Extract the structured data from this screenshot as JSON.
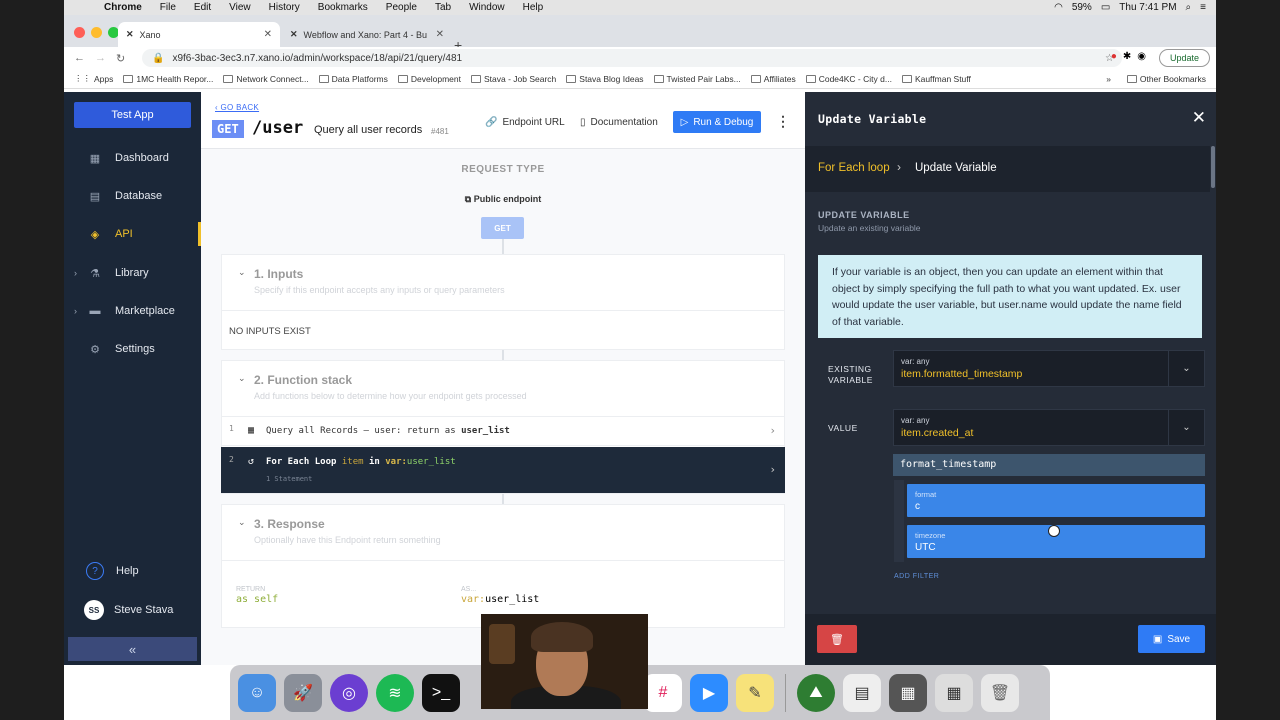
{
  "menubar": {
    "app": "Chrome",
    "items": [
      "File",
      "Edit",
      "View",
      "History",
      "Bookmarks",
      "People",
      "Tab",
      "Window",
      "Help"
    ],
    "battery": "59%",
    "clock": "Thu 7:41 PM"
  },
  "tabs": [
    {
      "title": "Xano"
    },
    {
      "title": "Webflow and Xano: Part 4 - Bu"
    }
  ],
  "address": {
    "url": "x9f6-3bac-3ec3.n7.xano.io/admin/workspace/18/api/21/query/481",
    "update_label": "Update"
  },
  "bookmarks": [
    "Apps",
    "1MC Health Repor...",
    "Network Connect...",
    "Data Platforms",
    "Development",
    "Stava - Job Search",
    "Stava Blog Ideas",
    "Twisted Pair Labs...",
    "Affiliates",
    "Code4KC - City d...",
    "Kauffman Stuff"
  ],
  "bookmarks_more": "»",
  "bookmarks_other": "Other Bookmarks",
  "sidebar": {
    "app_button": "Test App",
    "items": [
      {
        "label": "Dashboard",
        "icon": "dashboard-icon"
      },
      {
        "label": "Database",
        "icon": "database-icon"
      },
      {
        "label": "API",
        "icon": "api-icon"
      },
      {
        "label": "Library",
        "icon": "library-icon"
      },
      {
        "label": "Marketplace",
        "icon": "marketplace-icon"
      },
      {
        "label": "Settings",
        "icon": "gear-icon"
      }
    ],
    "help": "Help",
    "user_initials": "SS",
    "user_name": "Steve Stava",
    "collapse": "«"
  },
  "endpoint": {
    "go_back": "GO BACK",
    "method": "GET",
    "route": "/user",
    "description": "Query all user records",
    "id": "#481",
    "endpoint_url_btn": "Endpoint URL",
    "documentation_btn": "Documentation",
    "run_btn": "Run & Debug",
    "request_type": "REQUEST TYPE",
    "public_endpoint": "Public endpoint",
    "get_pill": "GET"
  },
  "inputs": {
    "title": "1. Inputs",
    "subtitle": "Specify if this endpoint accepts any inputs or query parameters",
    "empty": "NO INPUTS EXIST"
  },
  "function_stack": {
    "title": "2. Function stack",
    "subtitle": "Add functions below to determine how your endpoint gets processed",
    "rows": [
      {
        "num": "1",
        "text_a": "Query all Records – user: return as ",
        "text_b": "user_list"
      },
      {
        "num": "2",
        "text_a": "For Each Loop ",
        "item": "item",
        "in": " in ",
        "var": "var:",
        "list": "user_list",
        "sub": "1 Statement"
      }
    ]
  },
  "response": {
    "title": "3. Response",
    "subtitle": "Optionally have this Endpoint return something",
    "return_label": "RETURN",
    "return_value": "as self",
    "as_label": "AS...",
    "as_var": "var:",
    "as_value": "user_list"
  },
  "panel": {
    "title": "Update Variable",
    "crumb1": "For Each loop",
    "crumb2": "Update Variable",
    "section_title": "UPDATE VARIABLE",
    "section_sub": "Update an existing variable",
    "info": "If your variable is an object, then you can update an element within that object by simply specifying the full path to what you want updated. Ex. user would update the user variable, but user.name would update the name field of that variable.",
    "existing_label_1": "EXISTING",
    "existing_label_2": "VARIABLE",
    "existing_type": "var: any",
    "existing_value": "item.formatted_timestamp",
    "value_label": "VALUE",
    "value_type": "var: any",
    "value_value": "item.created_at",
    "filter_name": "format_timestamp",
    "param1_label": "format",
    "param1_value": "c",
    "param2_label": "timezone",
    "param2_value": "UTC",
    "add_filter": "ADD FILTER",
    "save": "Save"
  }
}
